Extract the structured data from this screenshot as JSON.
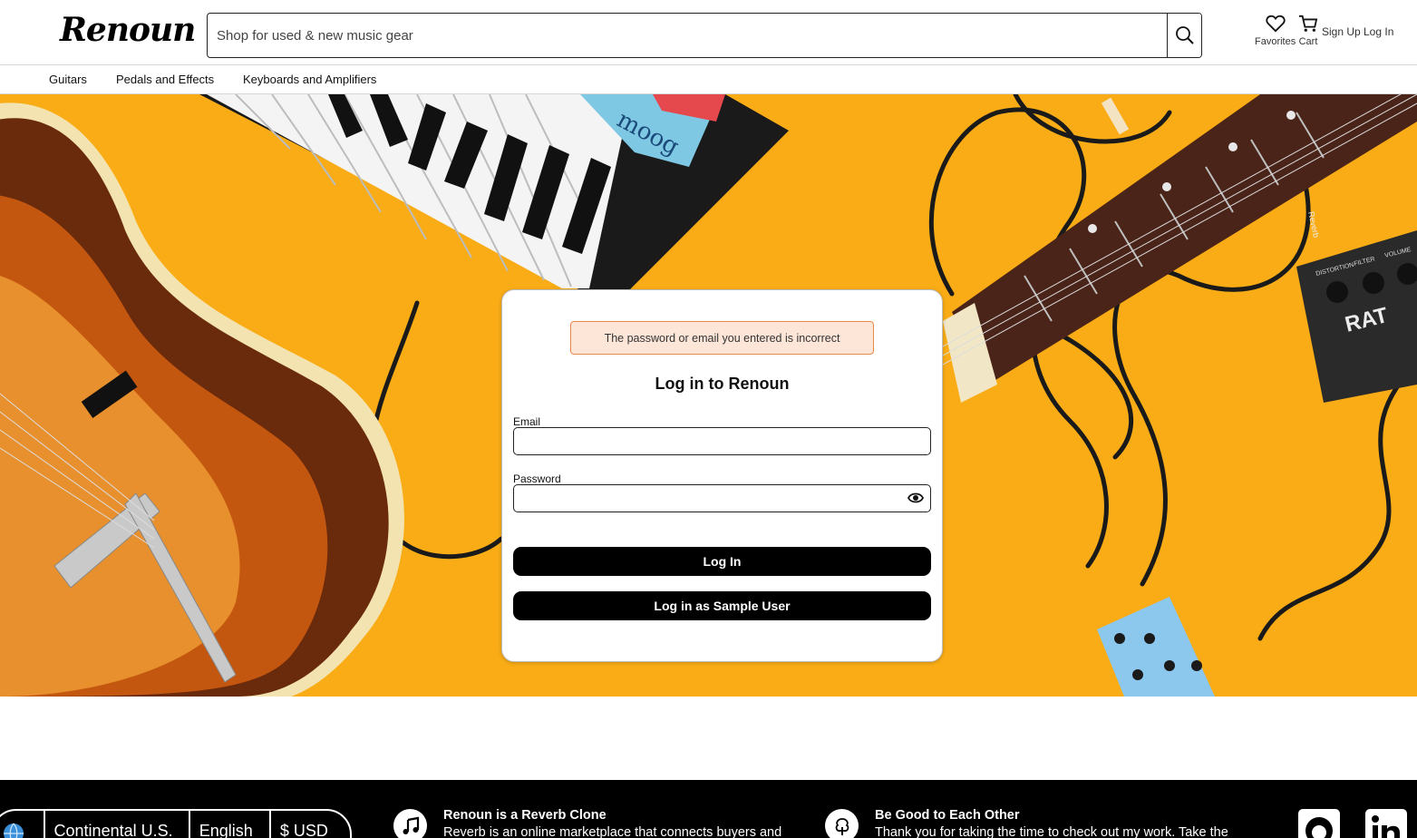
{
  "header": {
    "logo": "Renoun",
    "search_placeholder": "Shop for used & new music gear",
    "favorites_label": "Favorites",
    "cart_label": "Cart",
    "signup_label": "Sign Up",
    "login_label": "Log In"
  },
  "nav": {
    "items": [
      {
        "label": "Guitars"
      },
      {
        "label": "Pedals and Effects"
      },
      {
        "label": "Keyboards and Amplifiers"
      }
    ]
  },
  "login": {
    "error": "The password or email you entered is incorrect",
    "title": "Log in to Renoun",
    "email_label": "Email",
    "email_value": "",
    "password_label": "Password",
    "password_value": "",
    "login_button": "Log In",
    "sample_button": "Log in as Sample User"
  },
  "hero": {
    "keyboard_brand": "moog",
    "pedal_brand": "RAT",
    "pedal_knobs": [
      "DISTORTION",
      "FILTER",
      "VOLUME"
    ],
    "cable_brand": "Reverb"
  },
  "footer": {
    "region": "Continental U.S.",
    "language": "English",
    "currency": "$ USD",
    "about_title": "Renoun is a Reverb Clone",
    "about_text": "Reverb is an online marketplace that connects buyers and",
    "thanks_title": "Be Good to Each Other",
    "thanks_text": "Thank you for taking the time to check out my work. Take the"
  },
  "colors": {
    "hero_bg": "#f9ac15",
    "alert_bg": "#fde6d8",
    "alert_border": "#e98a4b",
    "button_bg": "#000000"
  }
}
